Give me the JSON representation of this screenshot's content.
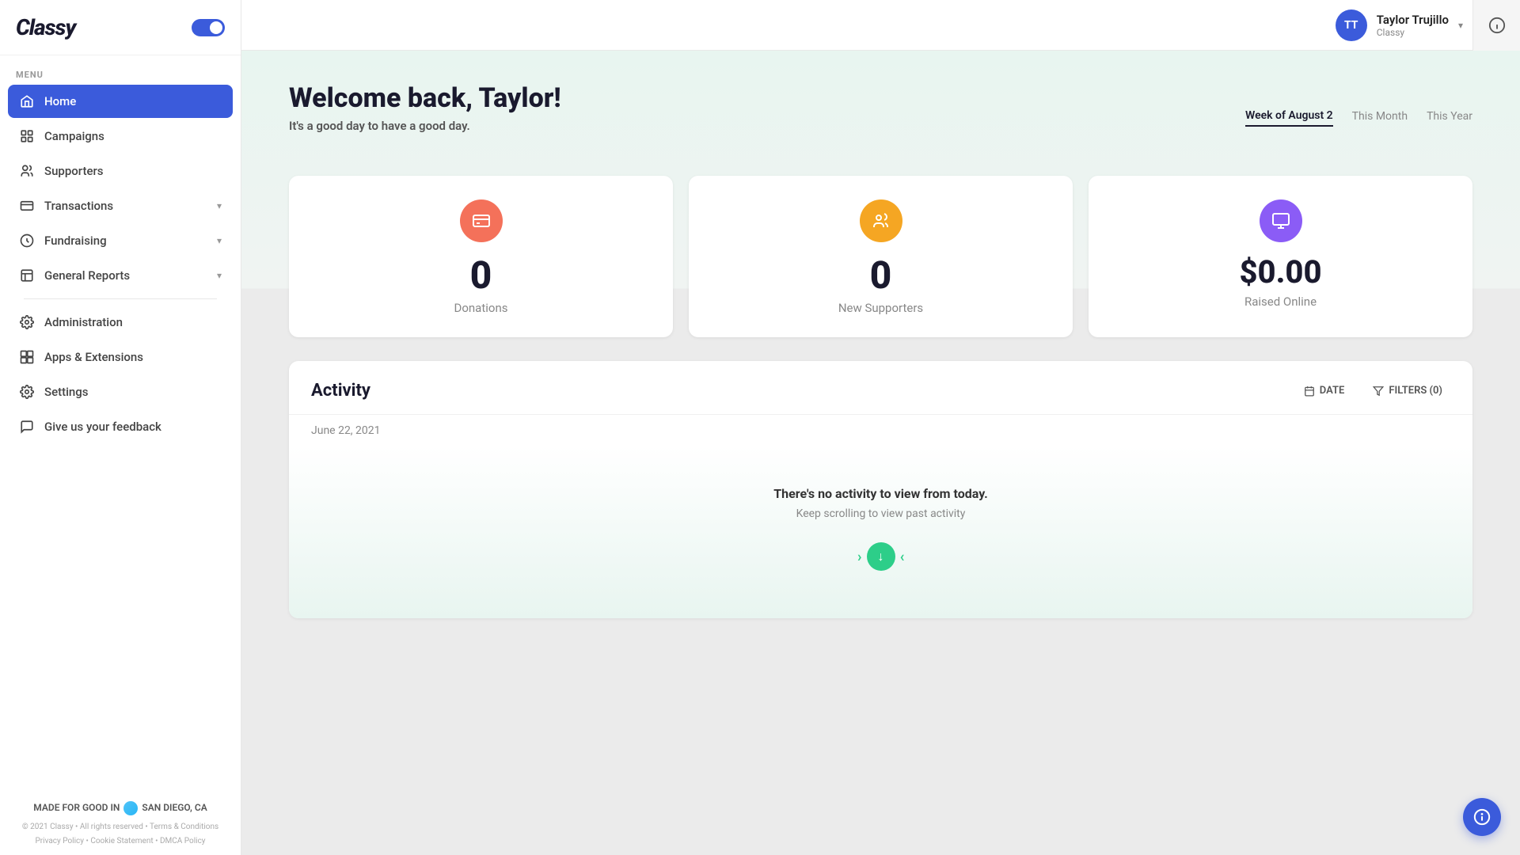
{
  "sidebar": {
    "logo": "Classy",
    "menu_label": "MENU",
    "nav_items": [
      {
        "id": "home",
        "label": "Home",
        "active": true,
        "has_chevron": false
      },
      {
        "id": "campaigns",
        "label": "Campaigns",
        "active": false,
        "has_chevron": false
      },
      {
        "id": "supporters",
        "label": "Supporters",
        "active": false,
        "has_chevron": false
      },
      {
        "id": "transactions",
        "label": "Transactions",
        "active": false,
        "has_chevron": true
      },
      {
        "id": "fundraising",
        "label": "Fundraising",
        "active": false,
        "has_chevron": true
      },
      {
        "id": "general-reports",
        "label": "General Reports",
        "active": false,
        "has_chevron": true
      },
      {
        "id": "administration",
        "label": "Administration",
        "active": false,
        "has_chevron": false
      },
      {
        "id": "apps-extensions",
        "label": "Apps & Extensions",
        "active": false,
        "has_chevron": false
      },
      {
        "id": "settings",
        "label": "Settings",
        "active": false,
        "has_chevron": false
      },
      {
        "id": "feedback",
        "label": "Give us your feedback",
        "active": false,
        "has_chevron": false
      }
    ],
    "footer": {
      "made_for_label": "MADE FOR GOOD IN",
      "city": "SAN DIEGO, CA",
      "copyright": "© 2021 Classy  •  All rights reserved  •  Terms & Conditions",
      "links": "Privacy Policy  •  Cookie Statement  •  DMCA Policy"
    }
  },
  "topbar": {
    "user_initials": "TT",
    "user_name": "Taylor Trujillo",
    "user_org": "Classy"
  },
  "main": {
    "welcome_title": "Welcome back, Taylor!",
    "welcome_subtitle": "It's a good day to have a good day.",
    "period_tabs": [
      {
        "id": "week",
        "label": "Week of August 2",
        "active": true
      },
      {
        "id": "month",
        "label": "This Month",
        "active": false
      },
      {
        "id": "year",
        "label": "This Year",
        "active": false
      }
    ],
    "stats": [
      {
        "id": "donations",
        "value": "0",
        "label": "Donations",
        "icon_color": "#f4715a",
        "icon": "💳"
      },
      {
        "id": "supporters",
        "value": "0",
        "label": "New Supporters",
        "icon_color": "#f5a623",
        "icon": "👥"
      },
      {
        "id": "raised",
        "value": "$0.00",
        "label": "Raised Online",
        "icon_color": "#8b5cf6",
        "icon": "🎬"
      }
    ],
    "activity": {
      "title": "Activity",
      "date_label": "June 22, 2021",
      "date_btn": "DATE",
      "filters_btn": "FILTERS (0)",
      "empty_title": "There's no activity to view from today.",
      "empty_subtitle": "Keep scrolling to view past activity"
    }
  }
}
